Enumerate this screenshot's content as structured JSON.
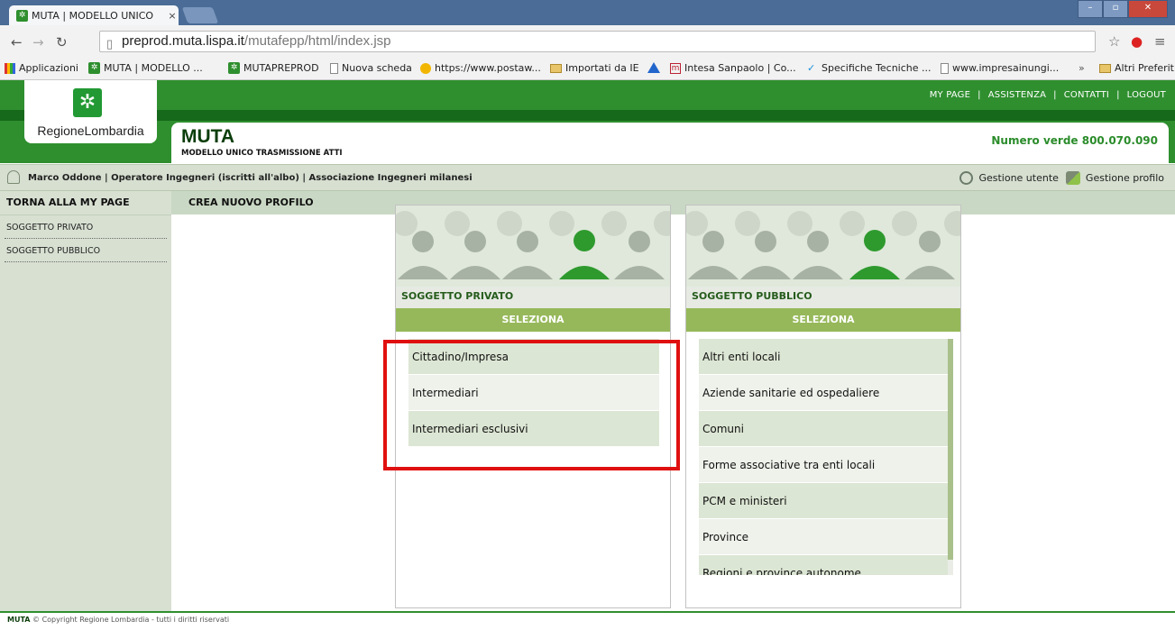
{
  "browser": {
    "tab_title": "MUTA | MODELLO UNICO",
    "tab_close": "×",
    "url_host": "preprod.muta.lispa.it",
    "url_path": "/mutafepp/html/index.jsp",
    "bookmarks": [
      {
        "icon": "apps-icon",
        "label": "Applicazioni"
      },
      {
        "icon": "muta-icon",
        "label": "MUTA | MODELLO ..."
      },
      {
        "icon": "muta-icon",
        "label": "MUTAPREPROD"
      },
      {
        "icon": "page-icon",
        "label": "Nuova scheda"
      },
      {
        "icon": "postal-icon",
        "label": "https://www.postaw..."
      },
      {
        "icon": "folder-icon",
        "label": "Importati da IE"
      },
      {
        "icon": "triangle-icon",
        "label": ""
      },
      {
        "icon": "m-icon",
        "label": "Intesa Sanpaolo | Co..."
      },
      {
        "icon": "bird-icon",
        "label": "Specifiche Tecniche ..."
      },
      {
        "icon": "page-icon",
        "label": "www.impresainungi..."
      },
      {
        "icon": "folder-icon",
        "label": "Altri Preferiti"
      }
    ],
    "bookmarks_overflow": "»"
  },
  "header": {
    "links": [
      "MY PAGE",
      "ASSISTENZA",
      "CONTATTI",
      "LOGOUT"
    ],
    "sep": "|",
    "logo_name": "RegioneLombardia",
    "app_title": "MUTA",
    "app_subtitle": "MODELLO UNICO TRASMISSIONE ATTI",
    "numero_verde": "Numero verde 800.070.090"
  },
  "userbar": {
    "user_info": "Marco Oddone | Operatore Ingegneri (iscritti all'albo) | Associazione Ingegneri milanesi",
    "gestione_utente": "Gestione utente",
    "gestione_profilo": "Gestione profilo"
  },
  "sidebar": {
    "back": "TORNA ALLA MY PAGE",
    "items": [
      "SOGGETTO PRIVATO",
      "SOGGETTO PUBBLICO"
    ]
  },
  "main": {
    "breadcrumb": "CREA NUOVO PROFILO",
    "cards": [
      {
        "label": "SOGGETTO PRIVATO",
        "select": "SELEZIONA",
        "options": [
          "Cittadino/Impresa",
          "Intermediari",
          "Intermediari esclusivi"
        ]
      },
      {
        "label": "SOGGETTO PUBBLICO",
        "select": "SELEZIONA",
        "options": [
          "Altri enti locali",
          "Aziende sanitarie ed ospedaliere",
          "Comuni",
          "Forme associative tra enti locali",
          "PCM e ministeri",
          "Province",
          "Regioni e province autonome"
        ]
      }
    ]
  },
  "footer": {
    "brand": "MUTA",
    "copyright": "© Copyright Regione Lombardia - tutti i diritti riservati"
  },
  "colors": {
    "brand_green": "#2f8f2f",
    "dark_green": "#16681a",
    "select_green": "#96b85a",
    "highlight_red": "#e01010"
  }
}
